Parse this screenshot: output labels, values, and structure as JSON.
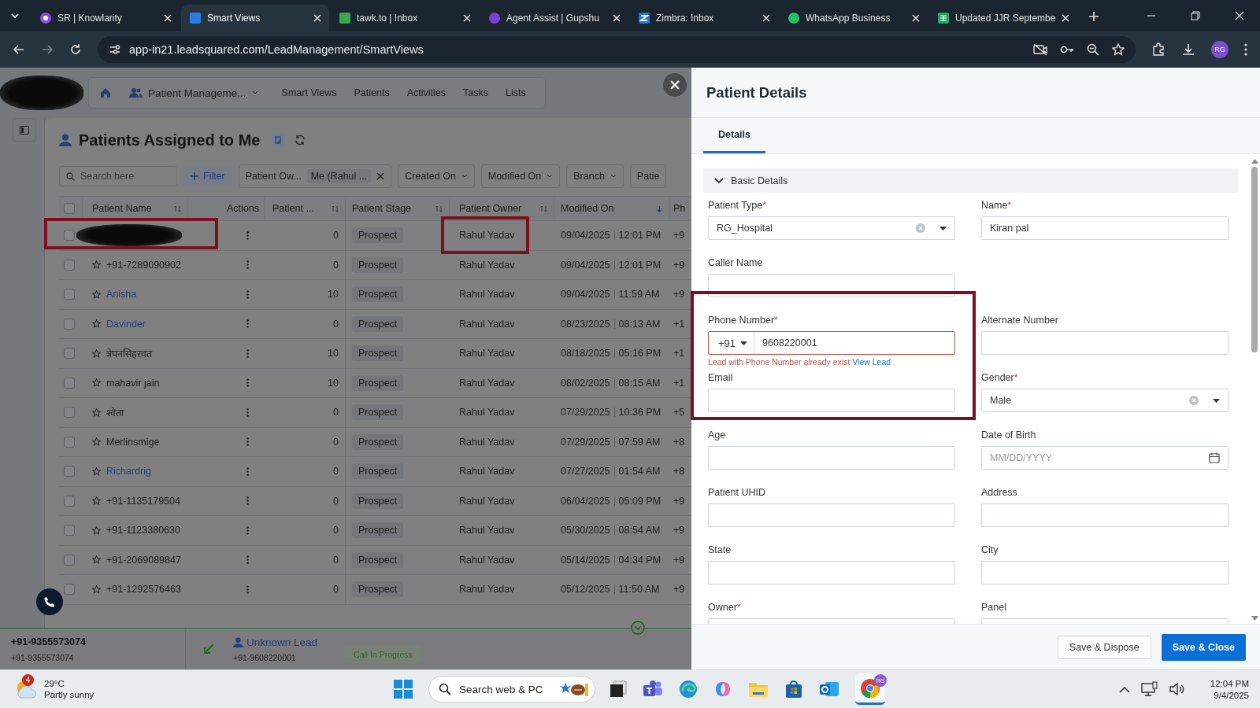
{
  "browser": {
    "tabs": [
      {
        "title": "SR | Knowlarity",
        "selected": false,
        "kind": "knowlarity"
      },
      {
        "title": "Smart Views",
        "selected": true,
        "kind": "leadsquared"
      },
      {
        "title": "tawk.to | Inbox",
        "selected": false,
        "kind": "tawk"
      },
      {
        "title": "Agent Assist | Gupshu",
        "selected": false,
        "kind": "gupshup"
      },
      {
        "title": "Zimbra: Inbox",
        "selected": false,
        "kind": "zimbra"
      },
      {
        "title": "WhatsApp Business",
        "selected": false,
        "kind": "whatsapp"
      },
      {
        "title": "Updated JJR Septembe",
        "selected": false,
        "kind": "sheets"
      }
    ],
    "url": "app-in21.leadsquared.com/LeadManagement/SmartViews",
    "profile": "RG"
  },
  "app": {
    "nav": {
      "module": "Patient Manageme...",
      "items": [
        "Smart Views",
        "Patients",
        "Activities",
        "Tasks",
        "Lists"
      ]
    },
    "view_title": "Patients Assigned to Me",
    "search": {
      "placeholder": "Search here"
    },
    "filter_button": "Filter",
    "filters": [
      {
        "label": "Patient Ow...",
        "value": "Me (Rahul ...",
        "removable": true
      },
      {
        "label": "Created On",
        "dropdown": true
      },
      {
        "label": "Modified On",
        "dropdown": true
      },
      {
        "label": "Branch",
        "dropdown": true
      },
      {
        "label": "Patie",
        "dropdown": false
      }
    ],
    "table": {
      "all_selected": false,
      "columns": [
        {
          "label": "Patient Name",
          "sortable": true,
          "sorted": false
        },
        {
          "label": "Actions",
          "sortable": false
        },
        {
          "label": "Patient ...",
          "sortable": true,
          "sorted": false
        },
        {
          "label": "Patient Stage",
          "sortable": true,
          "sorted": false
        },
        {
          "label": "Patient Owner",
          "sortable": true,
          "sorted": false
        },
        {
          "label": "Modified On",
          "sortable": true,
          "sorted": true
        },
        {
          "label": "Ph",
          "sortable": false
        }
      ],
      "rows": [
        {
          "redacted": true,
          "selected": false,
          "count": "0",
          "stage": "Prospect",
          "owner": "Rahul Yadav",
          "date": "09/04/2025",
          "time": "12:01 PM",
          "column_8": "+9"
        },
        {
          "name": "+91-7289090902",
          "link": false,
          "starred": false,
          "selected": false,
          "count": "0",
          "stage": "Prospect",
          "owner": "Rahul Yadav",
          "date": "09/04/2025",
          "time": "12:01 PM",
          "column_8": "+9"
        },
        {
          "name": "Anisha",
          "link": true,
          "starred": false,
          "selected": false,
          "count": "10",
          "stage": "Prospect",
          "owner": "Rahul Yadav",
          "date": "09/04/2025",
          "time": "11:59 AM",
          "column_8": "+9"
        },
        {
          "name": "Davinder",
          "link": true,
          "starred": false,
          "selected": false,
          "count": "0",
          "stage": "Prospect",
          "owner": "Rahul Yadav",
          "date": "08/23/2025",
          "time": "08:13 AM",
          "column_8": "+1"
        },
        {
          "name": "त्रेपनसिहरवत",
          "link": false,
          "starred": false,
          "selected": false,
          "count": "10",
          "stage": "Prospect",
          "owner": "Rahul Yadav",
          "date": "08/18/2025",
          "time": "05:16 PM",
          "column_8": "+1"
        },
        {
          "name": "mahavir jain",
          "link": false,
          "starred": false,
          "selected": false,
          "count": "10",
          "stage": "Prospect",
          "owner": "Rahul Yadav",
          "date": "08/02/2025",
          "time": "08:15 AM",
          "column_8": "+1"
        },
        {
          "name": "श्वेता",
          "link": false,
          "starred": false,
          "selected": false,
          "count": "0",
          "stage": "Prospect",
          "owner": "Rahul Yadav",
          "date": "07/29/2025",
          "time": "10:36 PM",
          "column_8": "+5"
        },
        {
          "name": "Merlinsmige",
          "link": false,
          "starred": false,
          "selected": false,
          "count": "0",
          "stage": "Prospect",
          "owner": "Rahul Yadav",
          "date": "07/29/2025",
          "time": "07:59 AM",
          "column_8": "+8"
        },
        {
          "name": "Richardrig",
          "link": true,
          "starred": false,
          "selected": false,
          "count": "0",
          "stage": "Prospect",
          "owner": "Rahul Yadav",
          "date": "07/27/2025",
          "time": "01:54 AM",
          "column_8": "+8"
        },
        {
          "name": "+91-1135179504",
          "link": false,
          "starred": false,
          "selected": false,
          "count": "0",
          "stage": "Prospect",
          "owner": "Rahul Yadav",
          "date": "06/04/2025",
          "time": "05:09 PM",
          "column_8": "+9"
        },
        {
          "name": "+91-1123380630",
          "link": false,
          "starred": false,
          "selected": false,
          "count": "0",
          "stage": "Prospect",
          "owner": "Rahul Yadav",
          "date": "05/30/2025",
          "time": "08:54 AM",
          "column_8": "+9"
        },
        {
          "name": "+91-2069089847",
          "link": false,
          "starred": false,
          "selected": false,
          "count": "0",
          "stage": "Prospect",
          "owner": "Rahul Yadav",
          "date": "05/14/2025",
          "time": "04:34 PM",
          "column_8": "+9"
        },
        {
          "name": "+91-1292576463",
          "link": false,
          "starred": false,
          "selected": false,
          "count": "0",
          "stage": "Prospect",
          "owner": "Rahul Yadav",
          "date": "05/12/2025",
          "time": "11:50 AM",
          "column_8": "+9"
        }
      ]
    },
    "call_bar": {
      "caller": "+91-9355573074",
      "caller_sub": "+91-9355573074",
      "lead": "Unknown Lead",
      "lead_number": "+91-9608220001",
      "status": "Call In Progress"
    }
  },
  "drawer": {
    "title": "Patient Details",
    "tabs": [
      {
        "label": "Details",
        "selected": true
      }
    ],
    "section": {
      "title": "Basic Details",
      "expanded": true
    },
    "fields": [
      {
        "label": "Patient Type",
        "required_mark": "*",
        "kind": "select",
        "value": "RG_Hospital"
      },
      {
        "label": "Name",
        "required_mark": "*",
        "kind": "text",
        "value": "Kiran pal"
      },
      {
        "label": "Caller Name",
        "kind": "text"
      },
      {
        "kind": "blank"
      },
      {
        "label": "Phone Number",
        "required_mark": "*",
        "kind": "phone",
        "country_code": "+91",
        "value": "9608220001",
        "error": "Lead with Phone Number already exist",
        "error_link": "View Lead"
      },
      {
        "label": "Alternate Number",
        "kind": "text"
      },
      {
        "label": "Email",
        "kind": "text"
      },
      {
        "label": "Gender",
        "required_mark": "*",
        "kind": "select",
        "value": "Male"
      },
      {
        "label": "Age",
        "kind": "text"
      },
      {
        "label": "Date of Birth",
        "kind": "date",
        "placeholder": "MM/DD/YYYY"
      },
      {
        "label": "Patient UHID",
        "kind": "text"
      },
      {
        "label": "Address",
        "kind": "text"
      },
      {
        "label": "State",
        "kind": "text"
      },
      {
        "label": "City",
        "kind": "text"
      },
      {
        "label": "Owner",
        "required_mark": "*",
        "kind": "text"
      },
      {
        "label": "Panel",
        "kind": "text"
      }
    ],
    "buttons": [
      {
        "label": "Save & Dispose",
        "kind": "secondary"
      },
      {
        "label": "Save & Close",
        "kind": "primary"
      }
    ]
  },
  "taskbar": {
    "weather": {
      "badge": "4",
      "temp": "29°C",
      "condition": "Partly sunny"
    },
    "search": {
      "placeholder": "Search web & PC"
    },
    "chrome_badge": "RG",
    "time": "12:04 PM",
    "date": "9/4/2025"
  }
}
